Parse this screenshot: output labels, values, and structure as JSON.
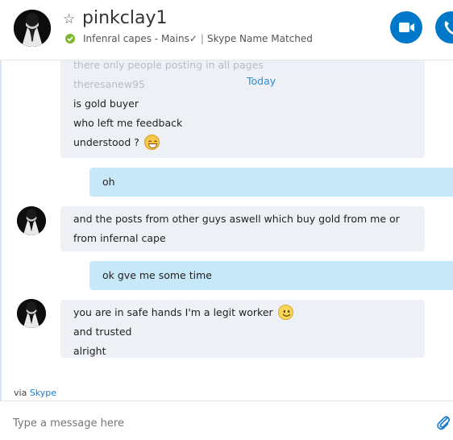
{
  "header": {
    "contact_name": "pinkclay1",
    "mood": "Infenral capes - Mains✓",
    "skype_name": "Skype Name Matched",
    "icons": {
      "favorite": "star-outline-icon",
      "status": "online-check-icon",
      "video_call": "video-camera-icon",
      "audio_call": "phone-icon"
    },
    "colors": {
      "call_button": "#0078ca",
      "status_online": "#7cb82f"
    }
  },
  "conversation": {
    "today_label": "Today",
    "messages": [
      {
        "direction": "incoming",
        "lines": [
          "there only people posting in all pages",
          "theresanew95",
          "is gold buyer",
          "who left me feedback",
          "understood ?"
        ],
        "emoji": "grin-emoji"
      },
      {
        "direction": "outgoing",
        "lines": [
          "oh"
        ]
      },
      {
        "direction": "incoming",
        "lines": [
          "and the posts from other guys aswell which buy gold from me  or",
          "from infernal cape"
        ]
      },
      {
        "direction": "outgoing",
        "lines": [
          "ok gve me some time"
        ]
      },
      {
        "direction": "incoming",
        "lines": [
          "you are in safe hands I'm a legit worker",
          "and trusted",
          "alright"
        ],
        "emoji": "smile-emoji"
      }
    ],
    "colors": {
      "incoming_bg": "#edf0f5",
      "outgoing_bg": "#c7e8f8",
      "link": "#2f8ed6"
    }
  },
  "footer": {
    "via_prefix": "via",
    "via_link": "Skype",
    "composer_placeholder": "Type a message here",
    "attach_icon": "paperclip-icon"
  }
}
